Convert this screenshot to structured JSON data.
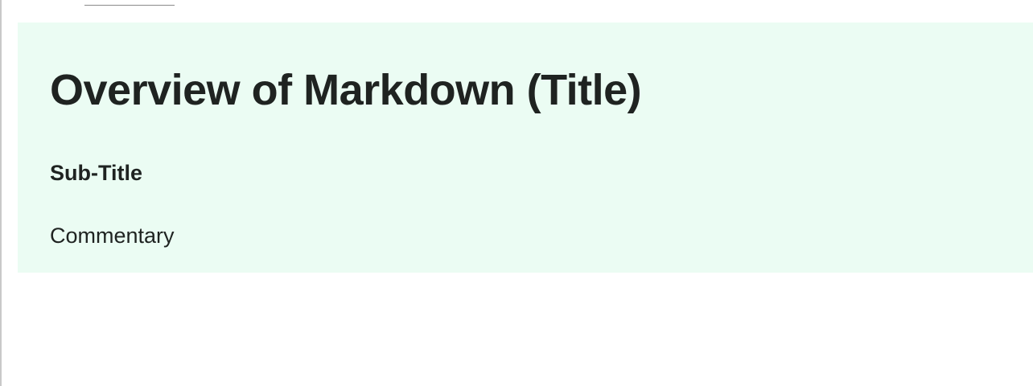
{
  "cell": {
    "title": "Overview of Markdown (Title)",
    "subtitle": "Sub-Title",
    "commentary": "Commentary"
  },
  "colors": {
    "cell_background": "#ebfcf3",
    "text": "#1f2321",
    "page_background": "#ffffff"
  }
}
